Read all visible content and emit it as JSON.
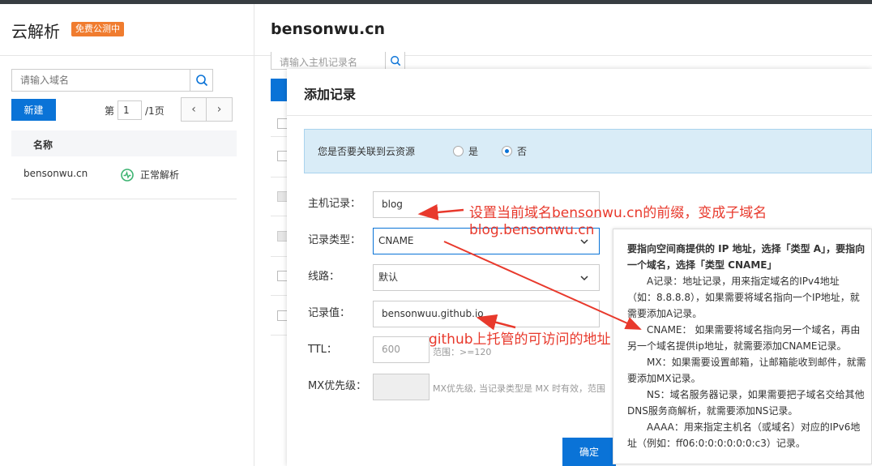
{
  "left": {
    "title": "云解析",
    "badge": "免费公测中",
    "search_placeholder": "请输入域名",
    "new_button": "新建",
    "pager_prefix": "第",
    "pager_page": "1",
    "pager_suffix": "/1页",
    "column_name": "名称",
    "domains": [
      {
        "name": "bensonwu.cn",
        "status": "正常解析"
      }
    ]
  },
  "main": {
    "title": "bensonwu.cn",
    "search_placeholder": "请输入主机记录名"
  },
  "modal": {
    "title": "添加记录",
    "link_question": "您是否要关联到云资源",
    "radio_yes": "是",
    "radio_no": "否",
    "radio_selected": "否",
    "host_label": "主机记录：",
    "host_value": "blog",
    "type_label": "记录类型：",
    "type_value": "CNAME",
    "line_label": "线路：",
    "line_value": "默认",
    "value_label": "记录值：",
    "value_value": "bensonwuu.github.io",
    "ttl_label": "TTL：",
    "ttl_value": "600",
    "ttl_hint": "范围：>=120",
    "mx_label": "MX优先级：",
    "mx_hint": "MX优先级, 当记录类型是 MX 时有效，范围",
    "confirm": "确定"
  },
  "tooltip": {
    "title": "要指向空间商提供的 IP 地址，选择「类型 A」，要指向一个域名，选择「类型 CNAME」",
    "items": [
      "A记录：地址记录，用来指定域名的IPv4地址（如：8.8.8.8），如果需要将域名指向一个IP地址，就需要添加A记录。",
      "CNAME： 如果需要将域名指向另一个域名，再由另一个域名提供ip地址，就需要添加CNAME记录。",
      "MX：如果需要设置邮箱，让邮箱能收到邮件，就需要添加MX记录。",
      "NS：域名服务器记录，如果需要把子域名交给其他DNS服务商解析，就需要添加NS记录。",
      "AAAA：用来指定主机名（或域名）对应的IPv6地址（例如：ff06:0:0:0:0:0:0:c3）记录。"
    ]
  },
  "annotations": {
    "prefix_note": "设置当前域名bensonwu.cn的前缀，变成子域名",
    "subdomain_note": "blog.bensonwu.cn",
    "github_note": "github上托管的可访问的地址"
  },
  "colors": {
    "primary": "#0a73d7",
    "badge": "#f07c2f",
    "annotation": "#e8392c",
    "status_ok": "#3cb371",
    "info_bg": "#d9ecf7"
  }
}
